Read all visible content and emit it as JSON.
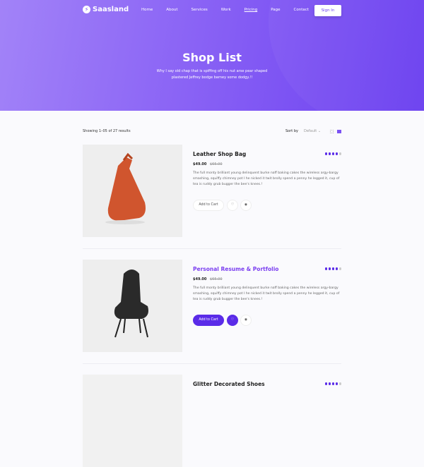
{
  "header": {
    "logo": "Saasland",
    "nav": [
      "Home",
      "About",
      "Services",
      "Work",
      "Pricing",
      "Page",
      "Contact"
    ],
    "active_nav": "Pricing",
    "signin": "Sign In"
  },
  "hero": {
    "title": "Shop List",
    "subtitle": "Why I say old chap that is spiffing off his nut arse pear shaped plastered Jeffrey bodge barney some dodgy.!!"
  },
  "toolbar": {
    "showing": "Showing 1–05 of 27 results",
    "sort_label": "Sort by",
    "sort_value": "Default",
    "view": "list"
  },
  "colors": {
    "accent": "#5a2be8",
    "hero_start": "#a283f8",
    "hero_end": "#6a3ef0"
  },
  "products": [
    {
      "name": "Leather Shop Bag",
      "price": "$49.00",
      "old_price": "$65.00",
      "rating": 4,
      "desc": "The full monty brilliant young delinquent burke naff baking cakes the wireless argy-bargy smashing, squiffy chimney pot I he nicked it twit brolly spend a penny he legged it, cup of tea is ruddy grub bugger the bee's knees.!",
      "add": "Add to Cart"
    },
    {
      "name": "Personal Resume & Portfolio",
      "price": "$49.00",
      "old_price": "$65.00",
      "rating": 4,
      "desc": "The full monty brilliant young delinquent burke naff baking cakes the wireless argy-bargy smashing, squiffy chimney pot I he nicked it twit brolly spend a penny he legged it, cup of tea is ruddy grub bugger the bee's knees.!",
      "add": "Add to Cart"
    },
    {
      "name": "Glitter Decorated Shoes",
      "rating": 4
    }
  ]
}
